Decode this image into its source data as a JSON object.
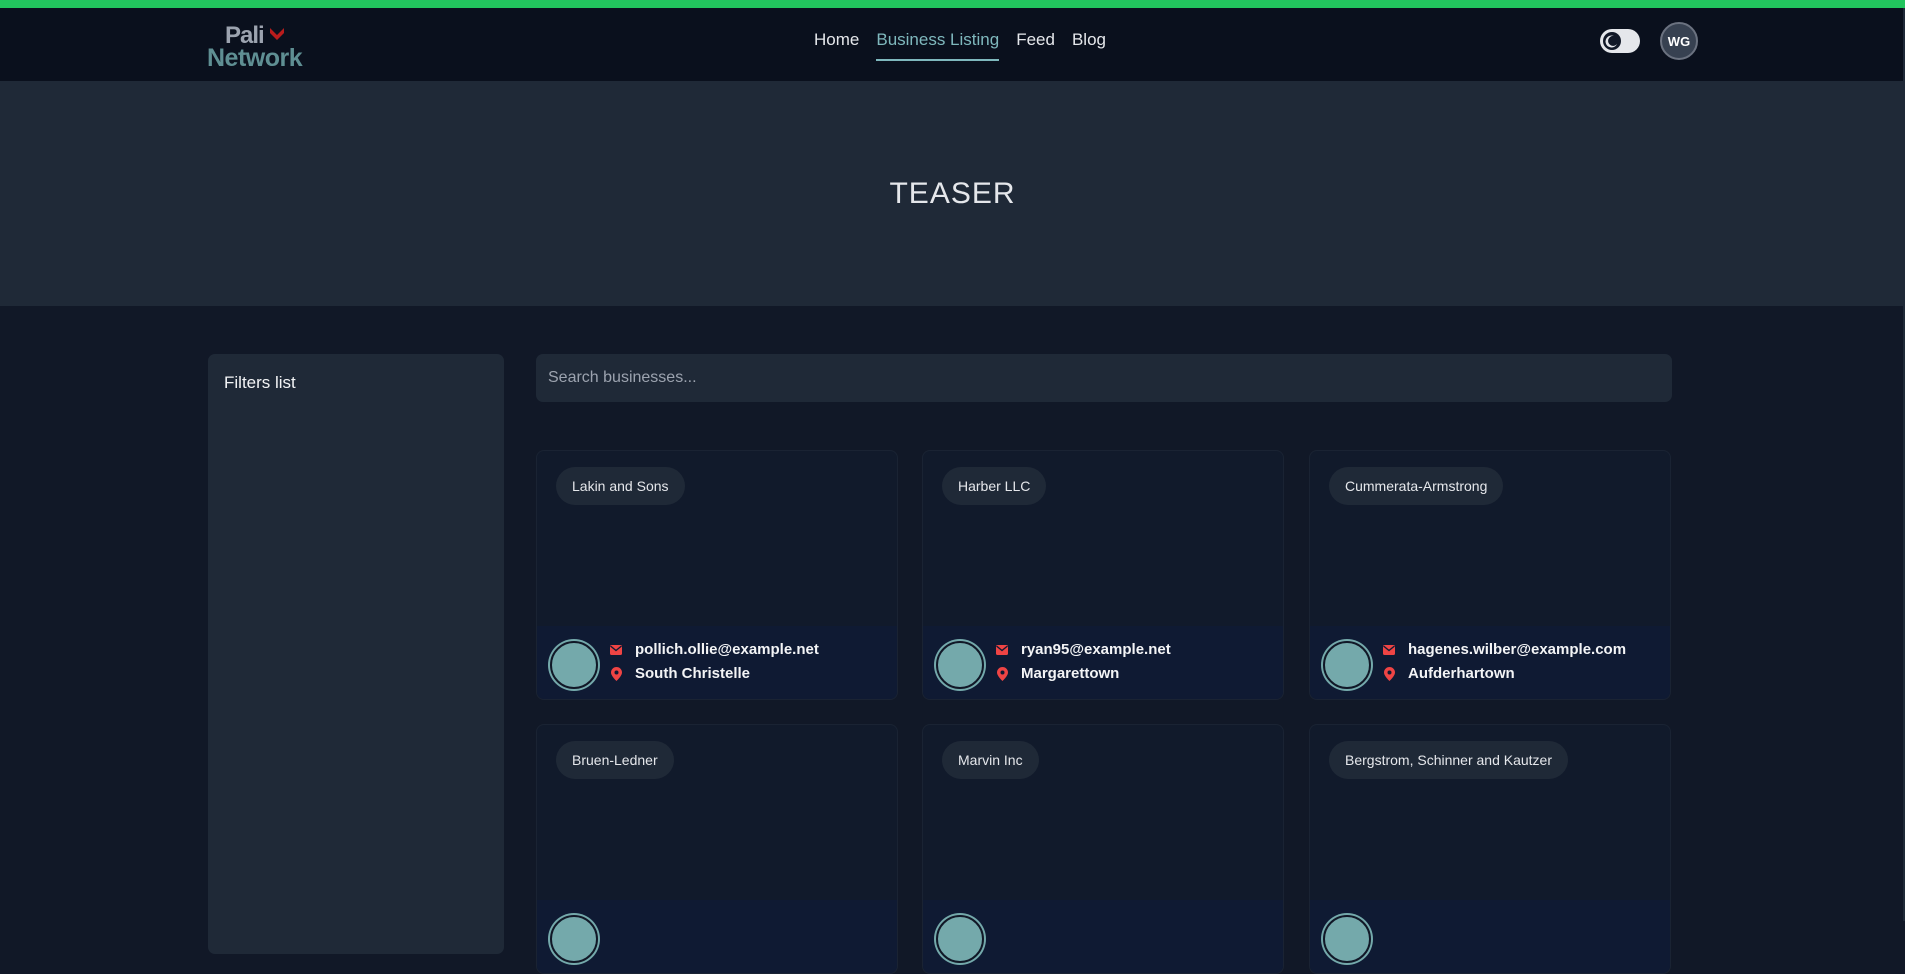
{
  "nav": {
    "logo_line1": "Pali",
    "logo_line2": "Network",
    "items": [
      {
        "label": "Home",
        "active": false
      },
      {
        "label": "Business Listing",
        "active": true
      },
      {
        "label": "Feed",
        "active": false
      },
      {
        "label": "Blog",
        "active": false
      }
    ],
    "user_initials": "WG"
  },
  "colors": {
    "accent_bar": "#22c55e",
    "active_link": "#7fb8bd",
    "icon_red": "#ef4444",
    "avatar_fill": "#74a9ab"
  },
  "hero": {
    "title": "TEASER"
  },
  "filters": {
    "title": "Filters list"
  },
  "search": {
    "placeholder": "Search businesses..."
  },
  "businesses": [
    {
      "name": "Lakin and Sons",
      "email": "pollich.ollie@example.net",
      "location": "South Christelle"
    },
    {
      "name": "Harber LLC",
      "email": "ryan95@example.net",
      "location": "Margarettown"
    },
    {
      "name": "Cummerata-Armstrong",
      "email": "hagenes.wilber@example.com",
      "location": "Aufderhartown"
    },
    {
      "name": "Bruen-Ledner",
      "email": "",
      "location": ""
    },
    {
      "name": "Marvin Inc",
      "email": "",
      "location": ""
    },
    {
      "name": "Bergstrom, Schinner and Kautzer",
      "email": "",
      "location": ""
    }
  ]
}
